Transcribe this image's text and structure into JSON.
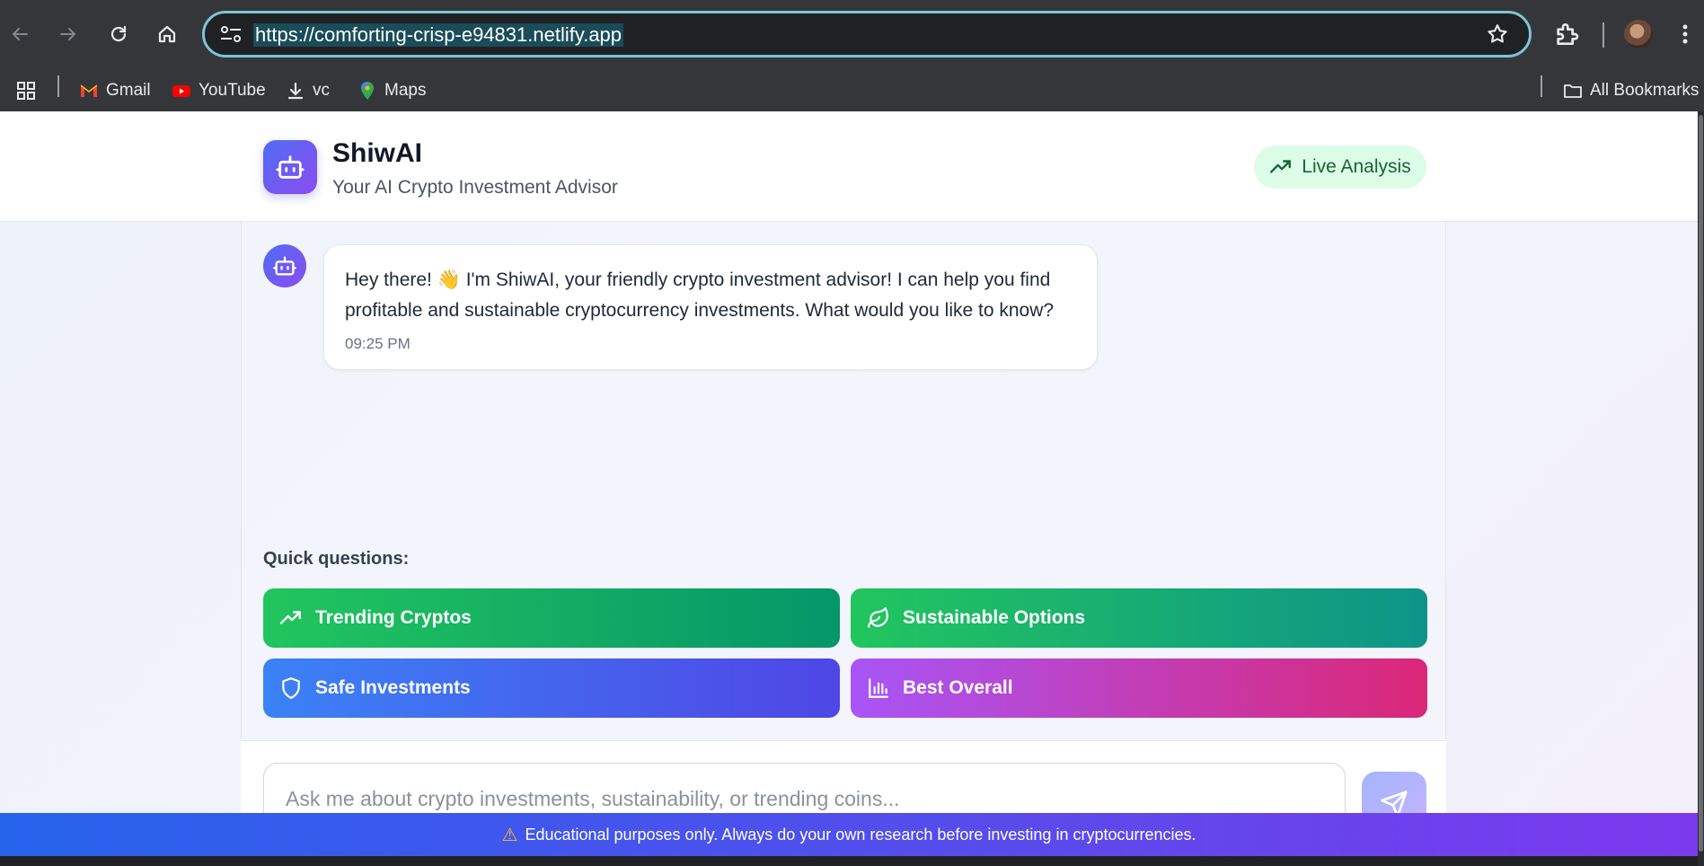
{
  "browser": {
    "url": "https://comforting-crisp-e94831.netlify.app",
    "bookmarks": [
      {
        "label": "Gmail",
        "icon": "gmail-icon"
      },
      {
        "label": "YouTube",
        "icon": "youtube-icon"
      },
      {
        "label": "vc",
        "icon": "download-icon"
      },
      {
        "label": "Maps",
        "icon": "maps-icon"
      }
    ],
    "all_bookmarks": "All Bookmarks"
  },
  "header": {
    "title": "ShiwAI",
    "subtitle": "Your AI Crypto Investment Advisor",
    "badge": "Live Analysis"
  },
  "chat": {
    "messages": [
      {
        "sender": "bot",
        "text": "Hey there! 👋 I'm ShiwAI, your friendly crypto investment advisor! I can help you find profitable and sustainable cryptocurrency investments. What would you like to know?",
        "time": "09:25 PM"
      }
    ]
  },
  "quick": {
    "label": "Quick questions:",
    "buttons": [
      {
        "label": "Trending Cryptos",
        "icon": "trending-up-icon"
      },
      {
        "label": "Sustainable Options",
        "icon": "leaf-icon"
      },
      {
        "label": "Safe Investments",
        "icon": "shield-icon"
      },
      {
        "label": "Best Overall",
        "icon": "bar-chart-icon"
      }
    ]
  },
  "composer": {
    "placeholder": "Ask me about crypto investments, sustainability, or trending coins..."
  },
  "footer": {
    "text": "Educational purposes only. Always do your own research before investing in cryptocurrencies."
  },
  "colors": {
    "accent": "#4f6cf5",
    "accent2": "#8b4cf0",
    "live_bg": "#dcfce7",
    "live_text": "#166534"
  }
}
